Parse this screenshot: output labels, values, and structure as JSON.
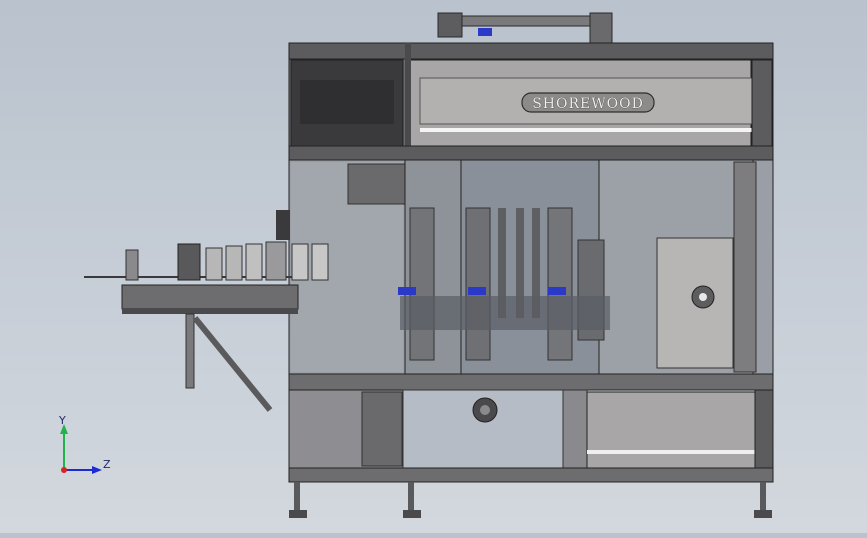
{
  "model": {
    "brand_text": "SHOREWOOD"
  },
  "triad": {
    "y_label": "Y",
    "z_label": "Z"
  },
  "colors": {
    "background_top": "#b9c2cd",
    "background_bottom": "#d3d8de",
    "frame_dark": "#3a3a3c",
    "frame_mid": "#6d6d70",
    "panel_light": "#a8a6a6",
    "guard_glass": "#9a9ea6",
    "accent_blue": "#2b39c8",
    "triad_y": "#22b24c",
    "triad_z": "#1c2bd6",
    "triad_origin": "#d62424"
  }
}
